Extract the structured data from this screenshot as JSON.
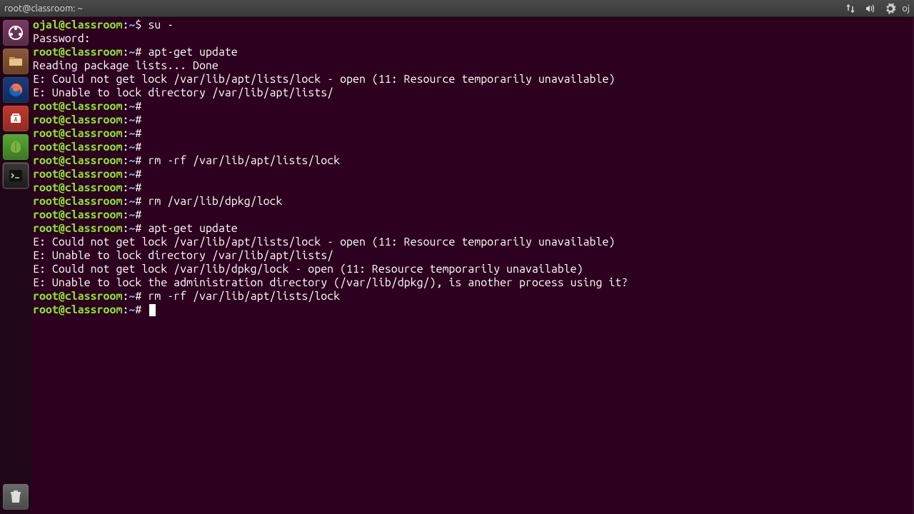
{
  "top_bar": {
    "window_title": "root@classroom: ~",
    "user_label": "oj"
  },
  "launcher": {
    "items": [
      {
        "name": "dash",
        "label": "Dash"
      },
      {
        "name": "files",
        "label": "Files"
      },
      {
        "name": "firefox",
        "label": "Firefox"
      },
      {
        "name": "software",
        "label": "Ubuntu Software"
      },
      {
        "name": "midori",
        "label": "Midori"
      },
      {
        "name": "terminal",
        "label": "Terminal",
        "active": true
      }
    ],
    "trash": {
      "label": "Trash"
    }
  },
  "terminal": {
    "lines": [
      {
        "type": "prompt",
        "user": "ojal@classroom",
        "path": "~",
        "sym": "$",
        "cmd": "su -"
      },
      {
        "type": "output",
        "text": "Password:"
      },
      {
        "type": "prompt",
        "user": "root@classroom",
        "path": "~",
        "sym": "#",
        "cmd": "apt-get update"
      },
      {
        "type": "output",
        "text": "Reading package lists... Done"
      },
      {
        "type": "output",
        "text": "E: Could not get lock /var/lib/apt/lists/lock - open (11: Resource temporarily unavailable)"
      },
      {
        "type": "output",
        "text": "E: Unable to lock directory /var/lib/apt/lists/"
      },
      {
        "type": "prompt",
        "user": "root@classroom",
        "path": "~",
        "sym": "#",
        "cmd": ""
      },
      {
        "type": "prompt",
        "user": "root@classroom",
        "path": "~",
        "sym": "#",
        "cmd": ""
      },
      {
        "type": "prompt",
        "user": "root@classroom",
        "path": "~",
        "sym": "#",
        "cmd": ""
      },
      {
        "type": "prompt",
        "user": "root@classroom",
        "path": "~",
        "sym": "#",
        "cmd": ""
      },
      {
        "type": "prompt",
        "user": "root@classroom",
        "path": "~",
        "sym": "#",
        "cmd": "rm -rf /var/lib/apt/lists/lock"
      },
      {
        "type": "prompt",
        "user": "root@classroom",
        "path": "~",
        "sym": "#",
        "cmd": ""
      },
      {
        "type": "prompt",
        "user": "root@classroom",
        "path": "~",
        "sym": "#",
        "cmd": ""
      },
      {
        "type": "prompt",
        "user": "root@classroom",
        "path": "~",
        "sym": "#",
        "cmd": "rm /var/lib/dpkg/lock"
      },
      {
        "type": "prompt",
        "user": "root@classroom",
        "path": "~",
        "sym": "#",
        "cmd": ""
      },
      {
        "type": "prompt",
        "user": "root@classroom",
        "path": "~",
        "sym": "#",
        "cmd": "apt-get update"
      },
      {
        "type": "output",
        "text": "E: Could not get lock /var/lib/apt/lists/lock - open (11: Resource temporarily unavailable)"
      },
      {
        "type": "output",
        "text": "E: Unable to lock directory /var/lib/apt/lists/"
      },
      {
        "type": "output",
        "text": "E: Could not get lock /var/lib/dpkg/lock - open (11: Resource temporarily unavailable)"
      },
      {
        "type": "output",
        "text": "E: Unable to lock the administration directory (/var/lib/dpkg/), is another process using it?"
      },
      {
        "type": "prompt",
        "user": "root@classroom",
        "path": "~",
        "sym": "#",
        "cmd": "rm -rf /var/lib/apt/lists/lock"
      },
      {
        "type": "prompt",
        "user": "root@classroom",
        "path": "~",
        "sym": "#",
        "cmd": "",
        "cursor": true
      }
    ]
  }
}
